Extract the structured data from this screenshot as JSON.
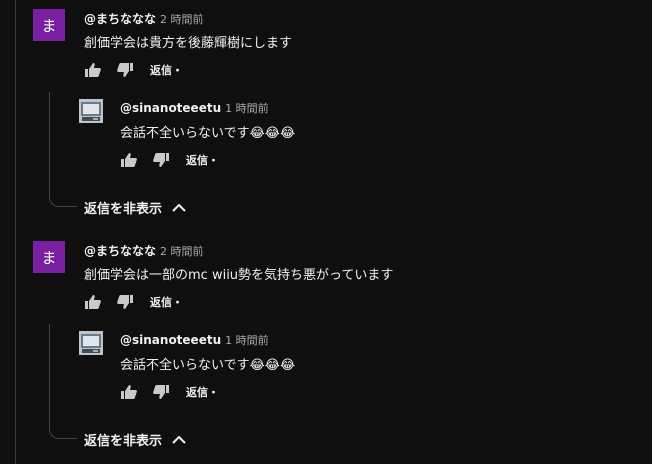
{
  "threads": [
    {
      "avatar_letter": "ま",
      "avatar_color": "#7b1fa2",
      "author": "@まちななな",
      "time": "2 時間前",
      "text": "創価学会は貴方を後藤輝樹にします",
      "reply_label": "返信・",
      "reply": {
        "author": "@sinanoteeetu",
        "time": "1 時間前",
        "text": "会話不全いらないです😂😂😂",
        "reply_label": "返信・"
      },
      "hide_replies_label": "返信を非表示"
    },
    {
      "avatar_letter": "ま",
      "avatar_color": "#7b1fa2",
      "author": "@まちななな",
      "time": "2 時間前",
      "text": "創価学会は一部のmc wiiu勢を気持ち悪がっています",
      "reply_label": "返信・",
      "reply": {
        "author": "@sinanoteeetu",
        "time": "1 時間前",
        "text": "会話不全いらないです😂😂😂",
        "reply_label": "返信・"
      },
      "hide_replies_label": "返信を非表示"
    }
  ],
  "icons": {
    "like": "thumbs-up-icon",
    "dislike": "thumbs-down-icon",
    "chevron": "chevron-up-icon"
  }
}
